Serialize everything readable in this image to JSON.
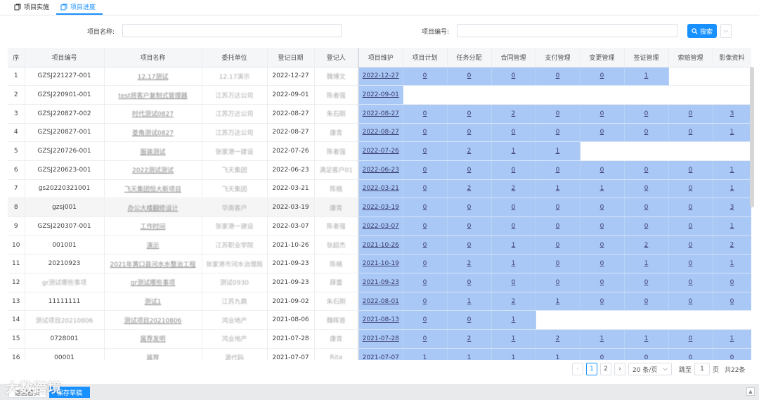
{
  "tabs": [
    {
      "label": "项目实施",
      "active": false
    },
    {
      "label": "项目进度",
      "active": true
    }
  ],
  "search": {
    "name_label": "项目名称:",
    "code_label": "项目编号:",
    "button_label": "搜索"
  },
  "table": {
    "left_headers": [
      "序",
      "项目编号",
      "项目名称",
      "委托单位",
      "登记日期",
      "登记人"
    ],
    "right_headers": [
      "项目维护",
      "项目计划",
      "任务分配",
      "合同管理",
      "支付管理",
      "变更管理",
      "签证管理",
      "索赔管理",
      "影像资料"
    ],
    "rows": [
      {
        "no": "1",
        "code": "GZSJ221227-001",
        "name": "12.17测试",
        "client": "12.17演示",
        "date": "2022-12-27",
        "registrant": "魏博文",
        "maint": "2022-12-27",
        "vals": [
          "0",
          "0",
          "0",
          "0",
          "0",
          "1"
        ],
        "blue_span": 7
      },
      {
        "no": "2",
        "code": "GZSJ220901-001",
        "name": "test将客户复制式管理器",
        "client": "江苏万达公司",
        "date": "2022-09-01",
        "registrant": "陈者强",
        "maint": "2022-09-01",
        "vals": [],
        "blue_span": 1
      },
      {
        "no": "3",
        "code": "GZSJ220827-002",
        "name": "时代测试0827",
        "client": "江苏万达公司",
        "date": "2022-08-27",
        "registrant": "朱石刚",
        "maint": "2022-08-27",
        "vals": [
          "0",
          "0",
          "2",
          "0",
          "0",
          "0",
          "0",
          "3"
        ],
        "blue_span": 9
      },
      {
        "no": "4",
        "code": "GZSJ220827-001",
        "name": "菱角测试0827",
        "client": "江苏万达公司",
        "date": "2022-08-27",
        "registrant": "康青",
        "maint": "2022-08-27",
        "vals": [
          "0",
          "0",
          "0",
          "0",
          "0",
          "0",
          "0",
          "1"
        ],
        "blue_span": 9
      },
      {
        "no": "5",
        "code": "GZSJ220726-001",
        "name": "服装测试",
        "client": "张家港一建设",
        "date": "2022-07-26",
        "registrant": "陈者强",
        "maint": "2022-07-26",
        "vals": [
          "0",
          "2",
          "1",
          "1"
        ],
        "blue_span": 5
      },
      {
        "no": "6",
        "code": "GZSJ220623-001",
        "name": "2022测试测试",
        "client": "飞天集团",
        "date": "2022-06-23",
        "registrant": "满足客户01",
        "maint": "2022-06-23",
        "vals": [
          "0",
          "0",
          "0",
          "0",
          "0",
          "0",
          "0",
          "1"
        ],
        "blue_span": 9
      },
      {
        "no": "7",
        "code": "gs20220321001",
        "name": "飞天集团恒大新项目",
        "client": "飞天集团",
        "date": "2022-03-21",
        "registrant": "陈楠",
        "maint": "2022-03-21",
        "vals": [
          "0",
          "2",
          "2",
          "1",
          "1",
          "0",
          "0",
          "1"
        ],
        "blue_span": 9
      },
      {
        "no": "8",
        "code": "gzsj001",
        "name": "办公大楼翻修设计",
        "client": "华南客户",
        "date": "2022-03-19",
        "registrant": "康青",
        "maint": "2022-03-19",
        "vals": [
          "0",
          "0",
          "0",
          "0",
          "0",
          "0",
          "0",
          "3"
        ],
        "blue_span": 9
      },
      {
        "no": "9",
        "code": "GZSJ220307-001",
        "name": "工作时间",
        "client": "张家港一建设",
        "date": "2022-03-07",
        "registrant": "陈者强",
        "maint": "2022-03-07",
        "vals": [
          "0",
          "0",
          "0",
          "0",
          "0",
          "0",
          "0",
          "1"
        ],
        "blue_span": 9
      },
      {
        "no": "10",
        "code": "001001",
        "name": "演示",
        "client": "江苏职业学院",
        "date": "2021-10-26",
        "registrant": "张超杰",
        "maint": "2021-10-26",
        "vals": [
          "0",
          "0",
          "1",
          "0",
          "0",
          "2",
          "0",
          "2"
        ],
        "blue_span": 9
      },
      {
        "no": "11",
        "code": "20210923",
        "name": "2021年黄口县河水水整治工程",
        "client": "张家港市河水治理局",
        "date": "2021-09-23",
        "registrant": "陈楠",
        "maint": "2021-10-19",
        "vals": [
          "0",
          "2",
          "1",
          "0",
          "0",
          "1",
          "0",
          "1"
        ],
        "blue_span": 9
      },
      {
        "no": "12",
        "code": "gr测试哪些事项",
        "name": "gr测试哪些事项",
        "client": "测试0930",
        "date": "2021-09-23",
        "registrant": "薛蕾",
        "maint": "2021-09-23",
        "vals": [
          "0",
          "0",
          "0",
          "0",
          "0",
          "0",
          "0",
          "0"
        ],
        "blue_span": 9
      },
      {
        "no": "13",
        "code": "11111111",
        "name": "测试1",
        "client": "江苏九鼎",
        "date": "2021-09-02",
        "registrant": "朱石刚",
        "maint": "2022-08-01",
        "vals": [
          "0",
          "1",
          "2",
          "1",
          "0",
          "0",
          "0",
          "0"
        ],
        "blue_span": 9
      },
      {
        "no": "14",
        "code": "测试项目20210806",
        "name": "测试项目20210806",
        "client": "鸿业地产",
        "date": "2021-08-06",
        "registrant": "魏晖普",
        "maint": "2021-08-13",
        "vals": [
          "0",
          "0",
          "1"
        ],
        "blue_span": 4
      },
      {
        "no": "15",
        "code": "0728001",
        "name": "属荐发明",
        "client": "鸿业地产",
        "date": "2021-07-28",
        "registrant": "康青",
        "maint": "2021-07-28",
        "vals": [
          "0",
          "2",
          "1",
          "2",
          "1",
          "1",
          "0",
          "1"
        ],
        "blue_span": 9
      },
      {
        "no": "16",
        "code": "00001",
        "name": "属荐",
        "client": "源代码",
        "date": "2021-07-07",
        "registrant": "Rita",
        "maint": "2021-07-07",
        "vals": [
          "1",
          "1",
          "1",
          "1",
          "0",
          "0",
          "0",
          "0"
        ],
        "blue_span": 9
      }
    ]
  },
  "pagination": {
    "pages": [
      "1",
      "2"
    ],
    "page_size": "20 条/页",
    "jump_label": "跳至",
    "jump_value": "1",
    "page_unit": "页",
    "total": "共22条"
  },
  "footer": {
    "back_label": "返回首页",
    "save_label": "保存草稿"
  },
  "watermark": "大数跨境",
  "colors": {
    "accent": "#1890ff",
    "highlight_blue": "#a9c8f5"
  }
}
